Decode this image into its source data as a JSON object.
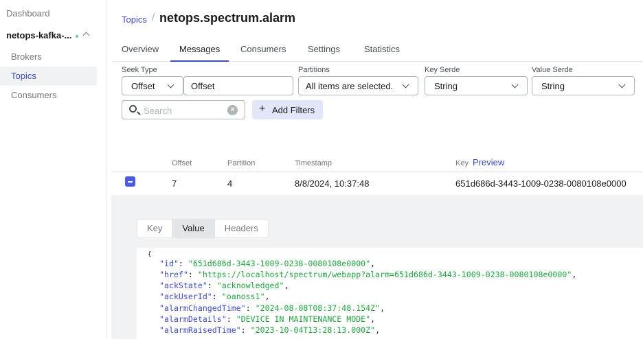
{
  "sidebar": {
    "dashboard": "Dashboard",
    "cluster_name": "netops-kafka-...",
    "items": [
      {
        "label": "Brokers"
      },
      {
        "label": "Topics"
      },
      {
        "label": "Consumers"
      }
    ]
  },
  "breadcrumb": {
    "parent": "Topics",
    "separator": "/",
    "title": "netops.spectrum.alarm"
  },
  "tabs": [
    "Overview",
    "Messages",
    "Consumers",
    "Settings",
    "Statistics"
  ],
  "filters": {
    "seek_type_label": "Seek Type",
    "seek_type_value": "Offset",
    "offset_value": "Offset",
    "partitions_label": "Partitions",
    "partitions_value": "All items are selected.",
    "key_serde_label": "Key Serde",
    "key_serde_value": "String",
    "value_serde_label": "Value Serde",
    "value_serde_value": "String",
    "search_placeholder": "Search",
    "add_filters": "Add Filters"
  },
  "table": {
    "headers": {
      "offset": "Offset",
      "partition": "Partition",
      "timestamp": "Timestamp",
      "key": "Key",
      "preview": "Preview"
    },
    "row": {
      "offset": "7",
      "partition": "4",
      "timestamp": "8/8/2024, 10:37:48",
      "key": "651d686d-3443-1009-0238-0080108e0000"
    }
  },
  "detail": {
    "tabs": [
      "Key",
      "Value",
      "Headers"
    ],
    "brace": "{",
    "json_lines": [
      {
        "k": "\"id\"",
        "v": "\"651d686d-3443-1009-0238-0080108e0000\""
      },
      {
        "k": "\"href\"",
        "v": "\"https://localhost/spectrum/webapp?alarm=651d686d-3443-1009-0238-0080108e0000\""
      },
      {
        "k": "\"ackState\"",
        "v": "\"acknowledged\""
      },
      {
        "k": "\"ackUserId\"",
        "v": "\"oanoss1\""
      },
      {
        "k": "\"alarmChangedTime\"",
        "v": "\"2024-08-08T08:37:48.154Z\""
      },
      {
        "k": "\"alarmDetails\"",
        "v": "\"DEVICE IN MAINTENANCE MODE\""
      },
      {
        "k": "\"alarmRaisedTime\"",
        "v": "\"2023-10-04T13:28:13.000Z\""
      }
    ]
  },
  "colors": {
    "accent": "#3e4cc2",
    "json_key": "#3e4cc2",
    "json_value": "#20a33d",
    "status_dot": "#5cd685"
  }
}
